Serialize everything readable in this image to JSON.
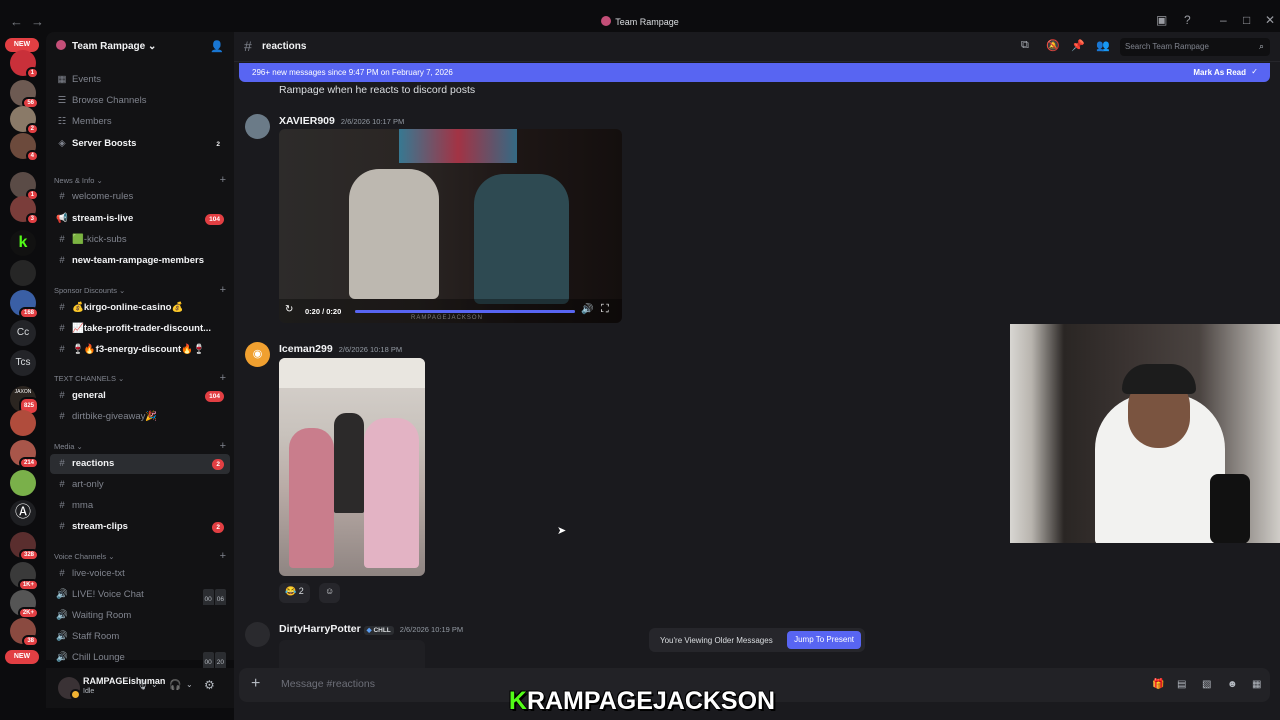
{
  "window": {
    "title": "Team Rampage"
  },
  "rail": {
    "new_label": "NEW",
    "badges": [
      "1",
      "56",
      "2",
      "4",
      "1",
      "3",
      "168",
      "825",
      "214",
      "328",
      "1K+",
      "2K+",
      "38"
    ],
    "text_servers": [
      "Cc",
      "Tcs"
    ],
    "jaxon_label": "JAXON"
  },
  "server": {
    "name": "Team Rampage",
    "top_items": [
      {
        "label": "Events",
        "icon": "calendar-icon"
      },
      {
        "label": "Browse Channels",
        "icon": "browse-icon"
      },
      {
        "label": "Members",
        "icon": "members-icon"
      },
      {
        "label": "Server Boosts",
        "icon": "boost-icon",
        "count": "2"
      }
    ],
    "categories": [
      {
        "name": "News & Info",
        "channels": [
          {
            "label": "welcome-rules",
            "icon": "#"
          },
          {
            "label": "stream-is-live",
            "icon": "📢",
            "count": "104"
          },
          {
            "label": "🟩-kick-subs",
            "icon": "#"
          },
          {
            "label": "new-team-rampage-members",
            "icon": "#"
          }
        ]
      },
      {
        "name": "Sponsor Discounts",
        "channels": [
          {
            "label": "💰kirgo-online-casino💰",
            "icon": "#"
          },
          {
            "label": "📈take-profit-trader-discount...",
            "icon": "#"
          },
          {
            "label": "🍷🔥f3-energy-discount🔥🍷",
            "icon": "#"
          }
        ]
      },
      {
        "name": "TEXT CHANNELS",
        "channels": [
          {
            "label": "general",
            "icon": "#",
            "count": "104"
          },
          {
            "label": "dirtbike-giveaway🎉",
            "icon": "#"
          }
        ]
      },
      {
        "name": "Media",
        "channels": [
          {
            "label": "reactions",
            "icon": "#",
            "count": "2"
          },
          {
            "label": "art-only",
            "icon": "#"
          },
          {
            "label": "mma",
            "icon": "#"
          },
          {
            "label": "stream-clips",
            "icon": "#",
            "count": "2"
          }
        ]
      },
      {
        "name": "Voice Channels",
        "channels": [
          {
            "label": "live-voice-txt",
            "icon": "#"
          },
          {
            "label": "LIVE! Voice Chat",
            "icon": "🔊",
            "vc": [
              "00",
              "06"
            ]
          },
          {
            "label": "Waiting Room",
            "icon": "🔊"
          },
          {
            "label": "Staff Room",
            "icon": "🔊"
          },
          {
            "label": "Chill Lounge",
            "icon": "🔊",
            "vc": [
              "00",
              "20"
            ]
          }
        ]
      }
    ]
  },
  "user": {
    "name": "RAMPAGEishuman",
    "status": "Idle"
  },
  "channel": {
    "name": "reactions",
    "search_placeholder": "Search Team Rampage"
  },
  "banner": {
    "text": "296+ new messages since 9:47 PM on February 7, 2026",
    "action": "Mark As Read"
  },
  "messages": [
    {
      "text": "Rampage when he reacts to discord posts"
    },
    {
      "author": "XAVIER909",
      "time": "2/6/2026 10:17 PM",
      "video_time": "0:20 / 0:20",
      "video_progress": 1.0,
      "watermark": "RAMPAGEJACKSON"
    },
    {
      "author": "Iceman299",
      "time": "2/6/2026 10:18 PM",
      "reaction_emoji": "😂",
      "reaction_count": "2"
    },
    {
      "author": "DirtyHarryPotter",
      "tag": "CHLL",
      "time": "2/6/2026 10:19 PM"
    }
  ],
  "toast": {
    "text": "You're Viewing Older Messages",
    "button": "Jump To Present"
  },
  "composer": {
    "placeholder": "Message #reactions"
  },
  "caption": {
    "k": "K",
    "rest": "RAMPAGEJACKSON"
  },
  "colors": {
    "accent": "#5865f2",
    "badge": "#e23f43",
    "kick_green": "#53fc18"
  }
}
